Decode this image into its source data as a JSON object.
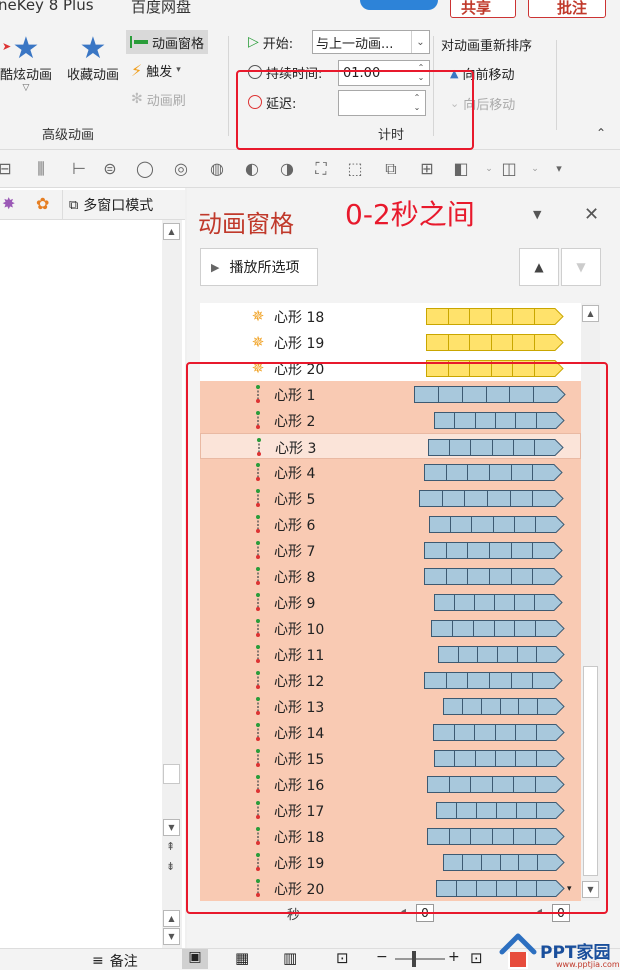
{
  "ribbon": {
    "tabs": [
      "neKey 8 Plus",
      "百度网盘"
    ],
    "share_label": "共享",
    "comment_label": "批注",
    "buttons": {
      "dazzle": "酷炫动画",
      "collect": "收藏动画",
      "anim_pane": "动画窗格",
      "trigger": "触发",
      "anim_brush": "动画刷"
    },
    "group_advanced": "高级动画",
    "timing": {
      "start_label": "开始:",
      "start_value": "与上一动画...",
      "duration_label": "持续时间:",
      "duration_value": "01.00",
      "delay_label": "延迟:",
      "delay_value": "",
      "group_label": "计时"
    },
    "reorder": {
      "title": "对动画重新排序",
      "move_earlier": "向前移动",
      "move_later": "向后移动"
    }
  },
  "left_panel": {
    "multiwindow_label": "多窗口模式"
  },
  "anim_pane": {
    "title": "动画窗格",
    "annotation": "0-2秒之间",
    "play_button": "播放所选项",
    "seconds_label": "秒",
    "timeline_start": "0",
    "timeline_end": "0",
    "items": [
      {
        "label": "心形 18",
        "type": "emphasis",
        "bar_start": 0.12,
        "bar_end": 0.91,
        "group": "top"
      },
      {
        "label": "心形 19",
        "type": "emphasis",
        "bar_start": 0.12,
        "bar_end": 0.91,
        "group": "top"
      },
      {
        "label": "心形 20",
        "type": "emphasis",
        "bar_start": 0.12,
        "bar_end": 0.91,
        "group": "top"
      },
      {
        "label": "心形 1",
        "type": "path",
        "bar_start": 0.05,
        "bar_end": 0.92,
        "group": "selected"
      },
      {
        "label": "心形 2",
        "type": "path",
        "bar_start": 0.17,
        "bar_end": 0.92,
        "group": "selected"
      },
      {
        "label": "心形 3",
        "type": "path",
        "bar_start": 0.13,
        "bar_end": 0.91,
        "group": "selected",
        "highlight": true
      },
      {
        "label": "心形 4",
        "type": "path",
        "bar_start": 0.11,
        "bar_end": 0.91,
        "group": "selected"
      },
      {
        "label": "心形 5",
        "type": "path",
        "bar_start": 0.08,
        "bar_end": 0.91,
        "group": "selected"
      },
      {
        "label": "心形 6",
        "type": "path",
        "bar_start": 0.14,
        "bar_end": 0.92,
        "group": "selected"
      },
      {
        "label": "心形 7",
        "type": "path",
        "bar_start": 0.11,
        "bar_end": 0.91,
        "group": "selected"
      },
      {
        "label": "心形 8",
        "type": "path",
        "bar_start": 0.11,
        "bar_end": 0.91,
        "group": "selected"
      },
      {
        "label": "心形 9",
        "type": "path",
        "bar_start": 0.17,
        "bar_end": 0.91,
        "group": "selected"
      },
      {
        "label": "心形 10",
        "type": "path",
        "bar_start": 0.15,
        "bar_end": 0.92,
        "group": "selected"
      },
      {
        "label": "心形 11",
        "type": "path",
        "bar_start": 0.19,
        "bar_end": 0.92,
        "group": "selected"
      },
      {
        "label": "心形 12",
        "type": "path",
        "bar_start": 0.11,
        "bar_end": 0.91,
        "group": "selected"
      },
      {
        "label": "心形 13",
        "type": "path",
        "bar_start": 0.22,
        "bar_end": 0.92,
        "group": "selected"
      },
      {
        "label": "心形 14",
        "type": "path",
        "bar_start": 0.16,
        "bar_end": 0.92,
        "group": "selected"
      },
      {
        "label": "心形 15",
        "type": "path",
        "bar_start": 0.17,
        "bar_end": 0.92,
        "group": "selected"
      },
      {
        "label": "心形 16",
        "type": "path",
        "bar_start": 0.13,
        "bar_end": 0.92,
        "group": "selected"
      },
      {
        "label": "心形 17",
        "type": "path",
        "bar_start": 0.18,
        "bar_end": 0.92,
        "group": "selected"
      },
      {
        "label": "心形 18",
        "type": "path",
        "bar_start": 0.13,
        "bar_end": 0.92,
        "group": "selected"
      },
      {
        "label": "心形 19",
        "type": "path",
        "bar_start": 0.22,
        "bar_end": 0.92,
        "group": "selected"
      },
      {
        "label": "心形 20",
        "type": "path",
        "bar_start": 0.18,
        "bar_end": 0.92,
        "group": "selected"
      }
    ]
  },
  "footer": {
    "notes_label": "备注"
  },
  "logo": {
    "text": "PPT家园",
    "url": "www.pptjia.com"
  },
  "colors": {
    "annotation_red": "#e8192c",
    "selected_bg": "#f9cab3",
    "highlight_bg": "#fbe4d9",
    "emphasis_bar": "#ffe26b",
    "path_bar": "#a8c8dc",
    "pane_title": "#c0392b"
  }
}
